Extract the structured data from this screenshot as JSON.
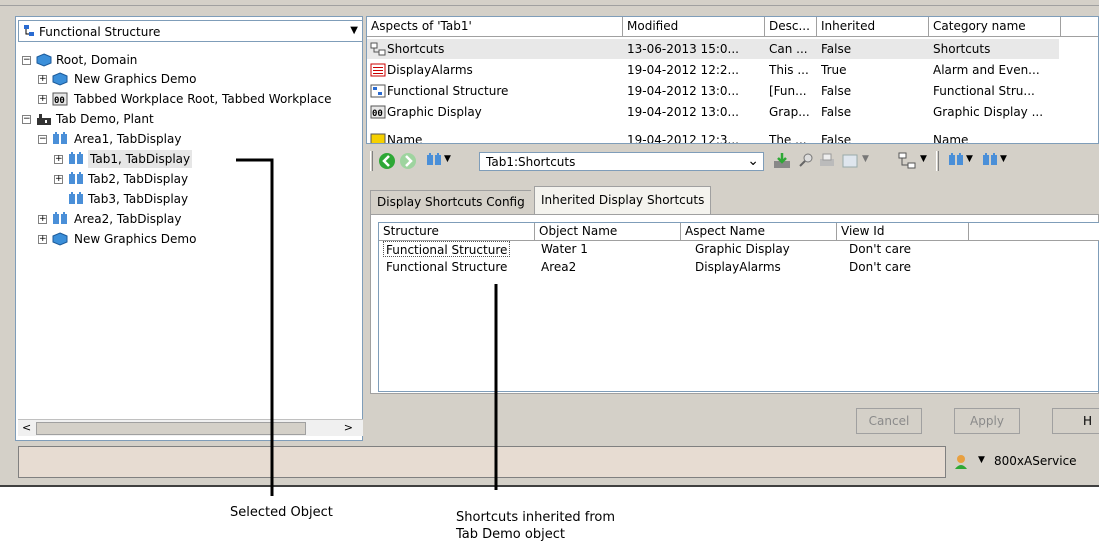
{
  "left_panel": {
    "structure_selector": "Functional Structure",
    "tree": [
      {
        "label": "Root, Domain",
        "icon": "domain-icon"
      },
      {
        "label": "New Graphics Demo",
        "icon": "domain-icon"
      },
      {
        "label": "Tabbed Workplace Root, Tabbed Workplace",
        "icon": "workplace-icon"
      },
      {
        "label": "Tab Demo, Plant",
        "icon": "plant-icon"
      },
      {
        "label": "Area1, TabDisplay",
        "icon": "tabdisplay-icon"
      },
      {
        "label": "Tab1, TabDisplay",
        "icon": "tabdisplay-icon"
      },
      {
        "label": "Tab2, TabDisplay",
        "icon": "tabdisplay-icon"
      },
      {
        "label": "Tab3, TabDisplay",
        "icon": "tabdisplay-icon"
      },
      {
        "label": "Area2, TabDisplay",
        "icon": "tabdisplay-icon"
      },
      {
        "label": "New Graphics Demo",
        "icon": "domain-icon"
      }
    ]
  },
  "aspects_list": {
    "headers": [
      "Aspects of 'Tab1'",
      "Modified",
      "Desc...",
      "Inherited",
      "Category name"
    ],
    "rows": [
      [
        "Shortcuts",
        "13-06-2013 15:0...",
        "Can ...",
        "False",
        "Shortcuts"
      ],
      [
        "DisplayAlarms",
        "19-04-2012 12:2...",
        "This ...",
        "True",
        "Alarm and Even..."
      ],
      [
        "Functional Structure",
        "19-04-2012 13:0...",
        "[Fun...",
        "False",
        "Functional Stru..."
      ],
      [
        "Graphic Display",
        "19-04-2012 13:0...",
        "Grap...",
        "False",
        "Graphic Display ..."
      ],
      [
        "Name",
        "19-04-2012 12:3...",
        "The ...",
        "False",
        "Name"
      ]
    ]
  },
  "toolbar": {
    "aspect_selector": "Tab1:Shortcuts"
  },
  "tabs": [
    "Display Shortcuts Config",
    "Inherited Display Shortcuts"
  ],
  "shortcuts_list": {
    "headers": [
      "Structure",
      "Object Name",
      "Aspect Name",
      "View Id"
    ],
    "rows": [
      [
        "Functional Structure",
        "Water 1",
        "Graphic Display",
        "Don't care"
      ],
      [
        "Functional Structure",
        "Area2",
        "DisplayAlarms",
        "Don't care"
      ]
    ]
  },
  "buttons": {
    "cancel": "Cancel",
    "apply": "Apply",
    "help": "H"
  },
  "status_bar": {
    "user": "800xAService"
  },
  "callouts": {
    "selected": "Selected Object",
    "inherited_line1": "Shortcuts inherited from",
    "inherited_line2": "Tab Demo object"
  }
}
